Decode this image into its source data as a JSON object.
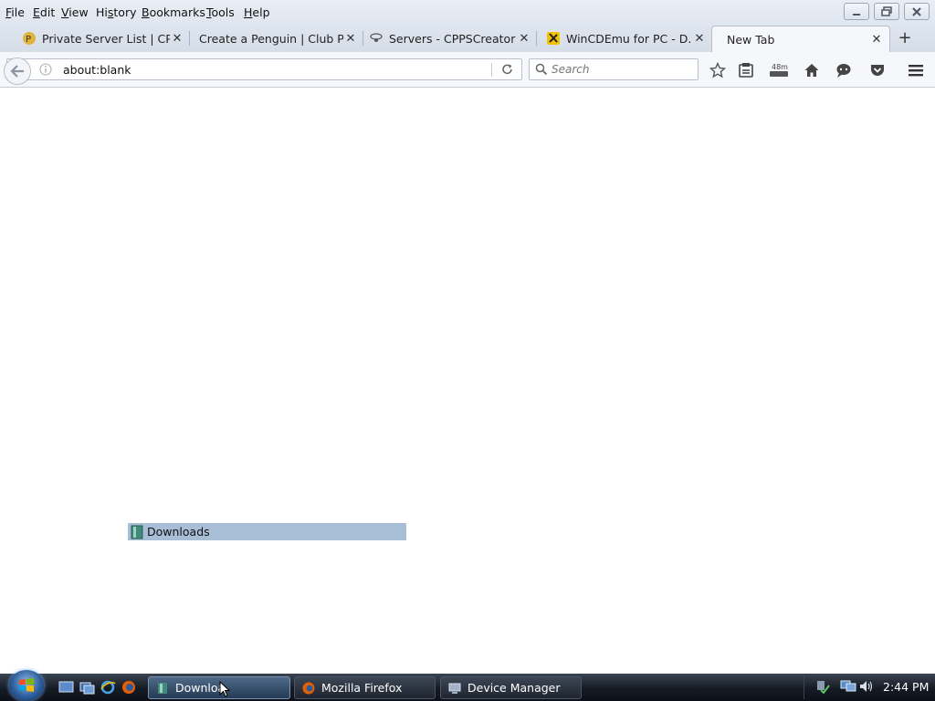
{
  "menubar": {
    "items": [
      {
        "label": "File",
        "accel": "F"
      },
      {
        "label": "Edit",
        "accel": "E"
      },
      {
        "label": "View",
        "accel": "V"
      },
      {
        "label": "History",
        "accel": "s"
      },
      {
        "label": "Bookmarks",
        "accel": "B"
      },
      {
        "label": "Tools",
        "accel": "T"
      },
      {
        "label": "Help",
        "accel": "H"
      }
    ]
  },
  "tabs": [
    {
      "title": "Private Server List | CPP...",
      "icon": "cpps-favicon"
    },
    {
      "title": "Create a Penguin | Club Pe...",
      "icon": "none"
    },
    {
      "title": "Servers - CPPSCreator",
      "icon": "cppscreator-favicon"
    },
    {
      "title": "WinCDEmu for PC - D...",
      "icon": "wincdemu-favicon"
    },
    {
      "title": "New Tab",
      "icon": "none",
      "active": true
    }
  ],
  "navbar": {
    "url": "about:blank",
    "search_placeholder": "Search",
    "reading_badge": "48m"
  },
  "drag_item": {
    "label": "Downloads"
  },
  "taskbar": {
    "buttons": [
      {
        "label": "Downloa",
        "icon": "folder-icon",
        "active": true
      },
      {
        "label": "Mozilla Firefox",
        "icon": "firefox-icon"
      },
      {
        "label": "Device Manager",
        "icon": "device-manager-icon"
      }
    ],
    "clock": "2:44 PM"
  },
  "colors": {
    "accent": "#a8bdd6",
    "taskbar": "#151b24",
    "chrome": "#dfe6ef"
  }
}
